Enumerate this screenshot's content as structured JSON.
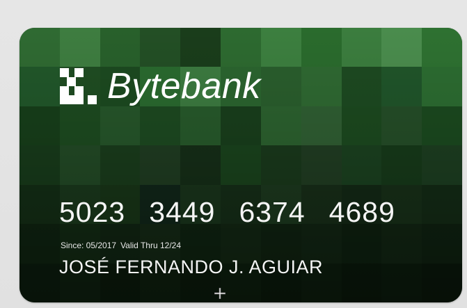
{
  "card": {
    "brand": "Bytebank",
    "number_groups": [
      "5023",
      "3449",
      "6374",
      "4689"
    ],
    "since_label": "Since: 05/2017",
    "valid_label": "Valid Thru 12/24",
    "holder": "JOSÉ FERNANDO J. AGUIAR"
  },
  "colors": {
    "background": "#e3e3e3",
    "card_text": "#ffffff",
    "mosaic": [
      [
        "#2f6a32",
        "#3e7d40",
        "#28602b",
        "#234f25",
        "#1a3d1b",
        "#2d6a30",
        "#3c7f3f",
        "#2a6b2d",
        "#3b7d3e",
        "#4a8c4d",
        "#2e7131"
      ],
      [
        "#21572a",
        "#1f4d22",
        "#1c4a20",
        "#2a6a2f",
        "#3c7b40",
        "#2b652f",
        "#2a5e2d",
        "#2f6932",
        "#1d4a21",
        "#20552a",
        "#2c6c31"
      ],
      [
        "#173f1a",
        "#1d4b20",
        "#26562a",
        "#1d4a21",
        "#275a2b",
        "#193f1c",
        "#2c622f",
        "#305f33",
        "#1c4a1f",
        "#254e28",
        "#1b4a1f"
      ],
      [
        "#183c1b",
        "#234b26",
        "#1a3d1c",
        "#203d22",
        "#162f18",
        "#1a441d",
        "#1a3a1c",
        "#213e23",
        "#1b4220",
        "#173b1a",
        "#1d3f21"
      ],
      [
        "#142f16",
        "#1b3a1d",
        "#193718",
        "#11271a",
        "#1a361c",
        "#162f18",
        "#1d3a1f",
        "#182f19",
        "#142a16",
        "#183119",
        "#142c16"
      ],
      [
        "#0f2411",
        "#132b14",
        "#112613",
        "#152a16",
        "#0f2411",
        "#132814",
        "#102311",
        "#122614",
        "#0e2110",
        "#122613",
        "#0f2211"
      ],
      [
        "#0c1d0e",
        "#0f2110",
        "#0b1b0c",
        "#0e200f",
        "#0b1b0c",
        "#0d1f0e",
        "#0a1a0b",
        "#0d1e0e",
        "#0a190b",
        "#0c1c0d",
        "#0a180b"
      ]
    ]
  },
  "icons": {
    "logo": "bytebank-pixel-logo-icon",
    "cursor": "crosshair-cursor-icon"
  }
}
